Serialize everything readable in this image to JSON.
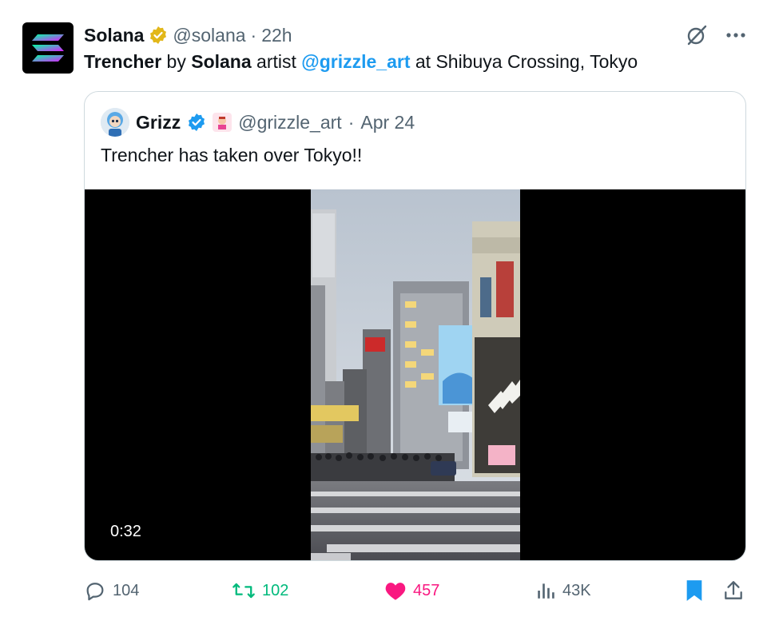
{
  "tweet": {
    "author_name": "Solana",
    "handle": "@solana",
    "separator": "·",
    "time": "22h",
    "body": {
      "part1": "Trencher",
      "part2": " by ",
      "part3": "Solana",
      "part4": " artist ",
      "mention": "@grizzle_art",
      "part5": " at Shibuya Crossing, Tokyo"
    },
    "icons": [
      "grok-icon",
      "more-icon",
      "verified-gold-badge"
    ]
  },
  "quote": {
    "author_name": "Grizz",
    "handle": "@grizzle_art",
    "separator": "·",
    "date": "Apr 24",
    "text": "Trencher has taken over Tokyo!!",
    "video_duration": "0:32"
  },
  "actions": {
    "replies": "104",
    "retweets": "102",
    "likes": "457",
    "views": "43K"
  },
  "colors": {
    "link": "#1d9bf0",
    "retweet": "#00ba7c",
    "like": "#f91880",
    "muted": "#536471",
    "bookmark": "#1d9bf0"
  }
}
